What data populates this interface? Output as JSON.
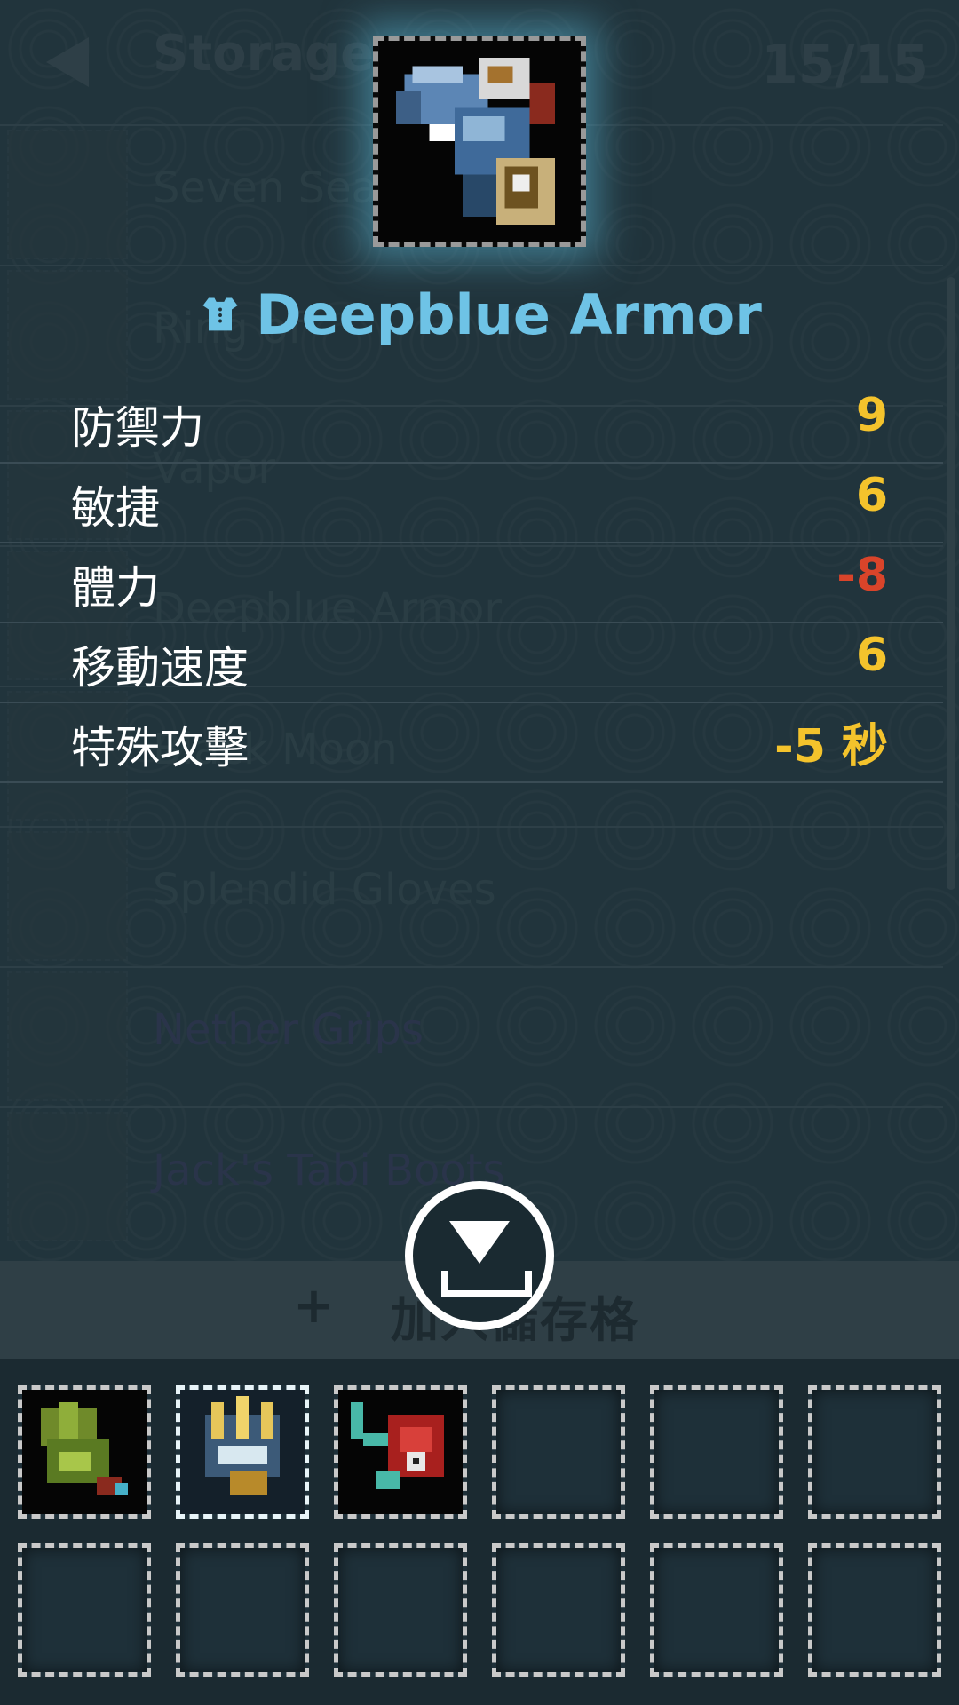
{
  "storage": {
    "title": "Storage",
    "capacity": "15/15",
    "items": [
      {
        "name": "Seven Seas",
        "color": "#34484f"
      },
      {
        "name": "Ring of",
        "color": "#34484f"
      },
      {
        "name": "Vapor",
        "color": "#34484f"
      },
      {
        "name": "Deepblue Armor",
        "color": "#34484f"
      },
      {
        "name": "Black Moon",
        "color": "#34484f"
      },
      {
        "name": "Splendid Gloves",
        "color": "#34484f"
      },
      {
        "name": "Nether Grips",
        "color": "#33375a"
      },
      {
        "name": "Jack's Tabi Boots",
        "color": "#33375a"
      }
    ]
  },
  "detail": {
    "name": "Deepblue Armor",
    "icon": "armor-icon",
    "stats": [
      {
        "label": "防禦力",
        "value": "9",
        "color": "#f4c32c"
      },
      {
        "label": "敏捷",
        "value": "6",
        "color": "#f4c32c"
      },
      {
        "label": "體力",
        "value": "-8",
        "color": "#d9442a"
      },
      {
        "label": "移動速度",
        "value": "6",
        "color": "#f4c32c"
      },
      {
        "label": "特殊攻擊",
        "value": "-5 秒",
        "color": "#f4c32c"
      }
    ]
  },
  "add_storage": {
    "plus": "+",
    "label": "加入儲存格"
  },
  "store_button_icon": "download-icon",
  "inventory": {
    "slots": [
      {
        "item": "green-gloves"
      },
      {
        "item": "golden-claw",
        "selected": true
      },
      {
        "item": "red-armor"
      },
      {
        "item": ""
      },
      {
        "item": ""
      },
      {
        "item": ""
      },
      {
        "item": ""
      },
      {
        "item": ""
      },
      {
        "item": ""
      },
      {
        "item": ""
      },
      {
        "item": ""
      },
      {
        "item": ""
      }
    ]
  }
}
